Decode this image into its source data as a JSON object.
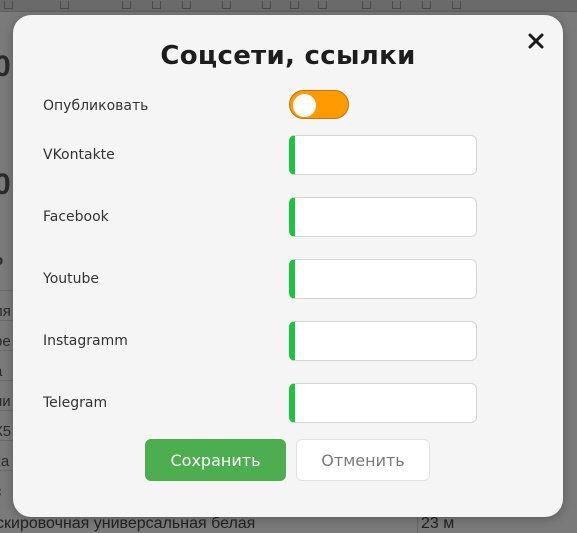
{
  "background": {
    "bottom_row_text": "скировочная универсальная белая",
    "bottom_row_value": "23 м",
    "left_fragments": [
      "0",
      "",
      "0",
      "",
      "о",
      "ля",
      "ре",
      "а",
      "ни",
      "К5",
      "ка",
      "с"
    ]
  },
  "modal": {
    "title": "Соцсети, ссылки",
    "close_label": "✕",
    "publish": {
      "label": "Опубликовать",
      "enabled": true,
      "on_color": "#ff9a00"
    },
    "fields": [
      {
        "label": "VKontakte",
        "value": "",
        "placeholder": ""
      },
      {
        "label": "Facebook",
        "value": "",
        "placeholder": ""
      },
      {
        "label": "Youtube",
        "value": "",
        "placeholder": ""
      },
      {
        "label": "Instagramm",
        "value": "",
        "placeholder": ""
      },
      {
        "label": "Telegram",
        "value": "",
        "placeholder": ""
      }
    ],
    "accent_color": "#1ec441",
    "save_label": "Сохранить",
    "save_color": "#4cae4f",
    "cancel_label": "Отменить"
  }
}
